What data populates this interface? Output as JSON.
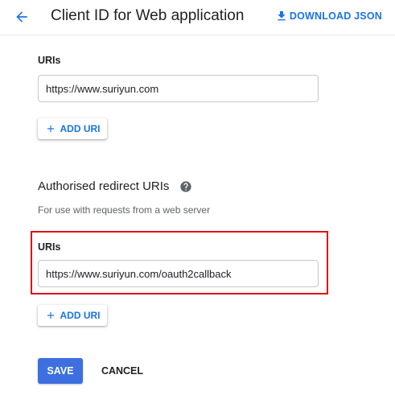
{
  "header": {
    "title": "Client ID for Web application",
    "download_label": "DOWNLOAD JSON"
  },
  "origins": {
    "label": "URIs",
    "value": "https://www.suriyun.com",
    "add_label": "ADD URI"
  },
  "redirect": {
    "heading": "Authorised redirect URIs",
    "helper": "For use with requests from a web server",
    "label": "URIs",
    "value": "https://www.suriyun.com/oauth2callback",
    "add_label": "ADD URI"
  },
  "actions": {
    "save_label": "SAVE",
    "cancel_label": "CANCEL"
  },
  "colors": {
    "accent": "#1a73e8",
    "save_bg": "#3d6fe0",
    "highlight": "#e0120f"
  },
  "icons": {
    "back": "arrow-back-icon",
    "download": "download-icon",
    "add": "plus-icon",
    "help": "help-circle-icon"
  }
}
